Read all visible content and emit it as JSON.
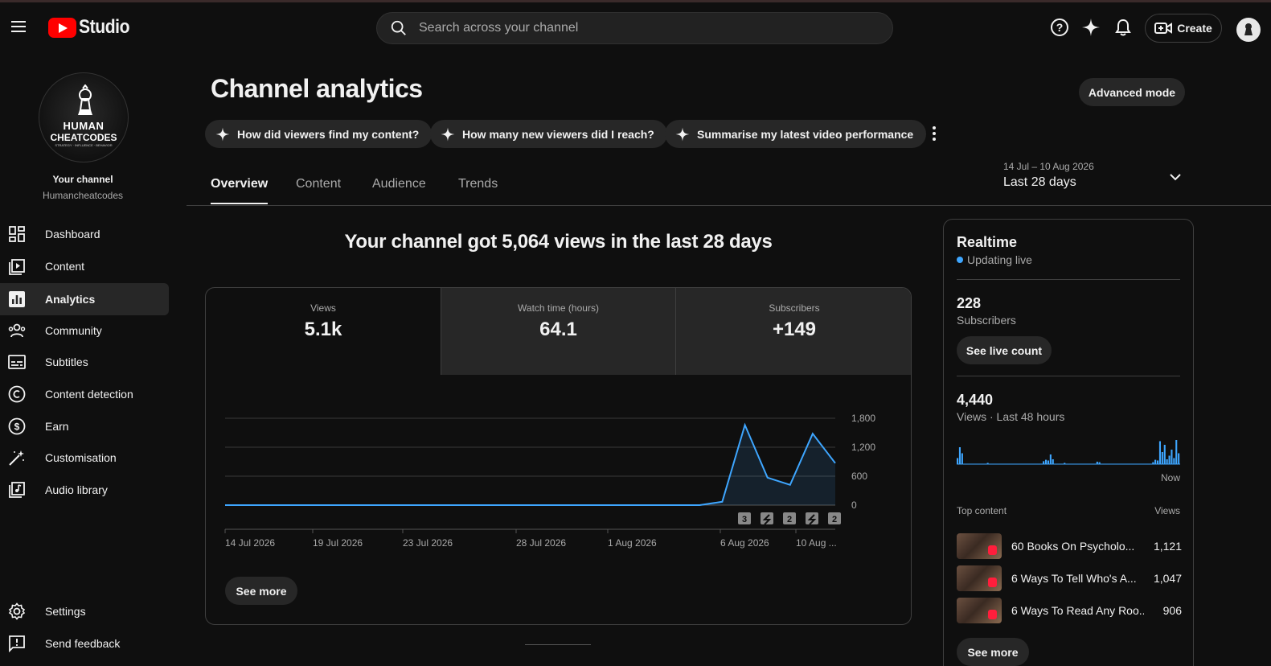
{
  "header": {
    "logo_text": "Studio",
    "search_placeholder": "Search across your channel",
    "create_label": "Create"
  },
  "sidebar": {
    "avatar_line1": "HUMAN",
    "avatar_line2": "CHEATCODES",
    "avatar_line3": "STRATEGY · INFLUENCE · BEHAVIOR",
    "your_channel": "Your channel",
    "handle": "Humancheatcodes",
    "items": [
      {
        "label": "Dashboard",
        "icon": "dashboard-icon"
      },
      {
        "label": "Content",
        "icon": "content-icon"
      },
      {
        "label": "Analytics",
        "icon": "analytics-icon",
        "active": true
      },
      {
        "label": "Community",
        "icon": "community-icon"
      },
      {
        "label": "Subtitles",
        "icon": "subtitles-icon"
      },
      {
        "label": "Content detection",
        "icon": "copyright-icon"
      },
      {
        "label": "Earn",
        "icon": "dollar-icon"
      },
      {
        "label": "Customisation",
        "icon": "magic-wand-icon"
      },
      {
        "label": "Audio library",
        "icon": "audio-library-icon"
      }
    ],
    "settings": "Settings",
    "feedback": "Send feedback"
  },
  "main": {
    "title": "Channel analytics",
    "advanced_mode": "Advanced mode",
    "chips": [
      "How did viewers find my content?",
      "How many new viewers did I reach?",
      "Summarise my latest video performance"
    ],
    "tabs": [
      "Overview",
      "Content",
      "Audience",
      "Trends"
    ],
    "date_range": {
      "dates": "14 Jul – 10 Aug 2026",
      "label": "Last 28 days"
    },
    "headline": "Your channel got 5,064 views in the last 28 days",
    "metrics": [
      {
        "title": "Views",
        "value": "5.1k"
      },
      {
        "title": "Watch time (hours)",
        "value": "64.1"
      },
      {
        "title": "Subscribers",
        "value": "+149"
      }
    ],
    "see_more": "See more"
  },
  "chart_data": {
    "type": "area",
    "x_labels": [
      "14 Jul 2026",
      "19 Jul 2026",
      "23 Jul 2026",
      "28 Jul 2026",
      "1 Aug 2026",
      "6 Aug 2026",
      "10 Aug ..."
    ],
    "y_ticks": [
      "1,800",
      "1,200",
      "600",
      "0"
    ],
    "ylim": [
      0,
      1800
    ],
    "series": [
      {
        "values": [
          0,
          0,
          0,
          0,
          0,
          0,
          0,
          0,
          0,
          0,
          0,
          0,
          0,
          0,
          0,
          0,
          0,
          0,
          0,
          0,
          0,
          0,
          70,
          1660,
          570,
          420,
          1480,
          870
        ]
      }
    ],
    "markers": [
      "3",
      "short",
      "2",
      "short",
      "2"
    ],
    "accent_color": "#3ea6ff"
  },
  "realtime": {
    "title": "Realtime",
    "live": "Updating live",
    "subs_value": "228",
    "subs_label": "Subscribers",
    "see_live": "See live count",
    "views_value": "4,440",
    "views_label": "Views · Last 48 hours",
    "now_label": "Now",
    "bars": [
      0.25,
      0.7,
      0.45,
      0,
      0,
      0,
      0,
      0,
      0,
      0,
      0,
      0,
      0,
      0.05,
      0,
      0,
      0,
      0,
      0,
      0,
      0,
      0,
      0,
      0,
      0,
      0,
      0,
      0,
      0,
      0,
      0,
      0,
      0,
      0,
      0,
      0,
      0,
      0.12,
      0.18,
      0.15,
      0.4,
      0.2,
      0,
      0,
      0,
      0,
      0.05,
      0,
      0,
      0,
      0,
      0,
      0,
      0,
      0,
      0,
      0,
      0,
      0,
      0,
      0.1,
      0.08,
      0,
      0,
      0,
      0,
      0,
      0,
      0,
      0,
      0,
      0,
      0,
      0,
      0,
      0,
      0,
      0,
      0,
      0,
      0,
      0,
      0,
      0,
      0.08,
      0.18,
      0.15,
      0.95,
      0.5,
      0.8,
      0.2,
      0.35,
      0.6,
      0.25,
      1.0,
      0.45
    ],
    "top_content_label": "Top content",
    "views_col": "Views",
    "top_content": [
      {
        "title": "60 Books On Psycholo...",
        "views": "1,121"
      },
      {
        "title": "6 Ways To Tell Who's A...",
        "views": "1,047"
      },
      {
        "title": "6 Ways To Read Any Roo...",
        "views": "906"
      }
    ],
    "see_more": "See more"
  }
}
